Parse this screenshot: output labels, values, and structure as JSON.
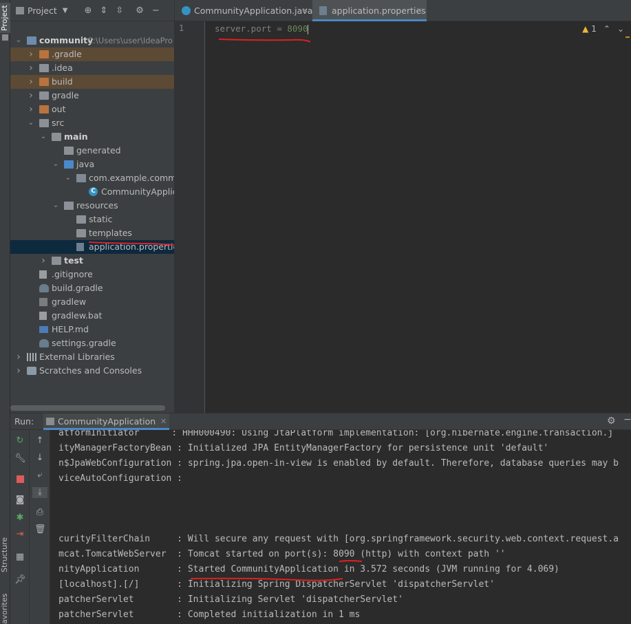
{
  "left_strip": {
    "project_label": "Project",
    "structure_label": "Structure",
    "favorites_label": "avorites"
  },
  "project_panel": {
    "title": "Project",
    "tree": [
      {
        "label": "community",
        "extra": "C:\\Users\\user\\IdeaPro",
        "depth": 0,
        "arrow": "down",
        "icon": "module-folder-icon",
        "bold": true,
        "state": "normal"
      },
      {
        "label": ".gradle",
        "depth": 1,
        "arrow": "right",
        "icon": "folder-orange-icon",
        "state": "highlight"
      },
      {
        "label": ".idea",
        "depth": 1,
        "arrow": "right",
        "icon": "folder-icon",
        "state": "normal"
      },
      {
        "label": "build",
        "depth": 1,
        "arrow": "right",
        "icon": "folder-orange-icon",
        "state": "highlight"
      },
      {
        "label": "gradle",
        "depth": 1,
        "arrow": "right",
        "icon": "folder-icon",
        "state": "normal"
      },
      {
        "label": "out",
        "depth": 1,
        "arrow": "right",
        "icon": "folder-orange-icon",
        "state": "normal"
      },
      {
        "label": "src",
        "depth": 1,
        "arrow": "down",
        "icon": "folder-icon",
        "state": "normal"
      },
      {
        "label": "main",
        "depth": 2,
        "arrow": "down",
        "icon": "folder-icon",
        "bold": true,
        "state": "normal"
      },
      {
        "label": "generated",
        "depth": 3,
        "arrow": "",
        "icon": "generated-folder-icon",
        "state": "normal"
      },
      {
        "label": "java",
        "depth": 3,
        "arrow": "down",
        "icon": "source-folder-icon",
        "state": "normal"
      },
      {
        "label": "com.example.commun",
        "depth": 4,
        "arrow": "down",
        "icon": "package-icon",
        "state": "normal"
      },
      {
        "label": "CommunityApplicat",
        "depth": 5,
        "arrow": "",
        "icon": "class-icon",
        "state": "normal"
      },
      {
        "label": "resources",
        "depth": 3,
        "arrow": "down",
        "icon": "resources-folder-icon",
        "state": "normal"
      },
      {
        "label": "static",
        "depth": 4,
        "arrow": "",
        "icon": "folder-icon",
        "state": "normal"
      },
      {
        "label": "templates",
        "depth": 4,
        "arrow": "",
        "icon": "folder-icon",
        "state": "normal"
      },
      {
        "label": "application.properties",
        "depth": 4,
        "arrow": "",
        "icon": "properties-file-icon",
        "state": "selected"
      },
      {
        "label": "test",
        "depth": 2,
        "arrow": "right",
        "icon": "folder-icon",
        "bold": true,
        "state": "normal"
      },
      {
        "label": ".gitignore",
        "depth": 1,
        "arrow": "",
        "icon": "text-file-icon",
        "state": "normal"
      },
      {
        "label": "build.gradle",
        "depth": 1,
        "arrow": "",
        "icon": "gradle-icon",
        "state": "normal"
      },
      {
        "label": "gradlew",
        "depth": 1,
        "arrow": "",
        "icon": "terminal-file-icon",
        "state": "normal"
      },
      {
        "label": "gradlew.bat",
        "depth": 1,
        "arrow": "",
        "icon": "text-file-icon",
        "state": "normal"
      },
      {
        "label": "HELP.md",
        "depth": 1,
        "arrow": "",
        "icon": "markdown-icon",
        "state": "normal"
      },
      {
        "label": "settings.gradle",
        "depth": 1,
        "arrow": "",
        "icon": "gradle-icon",
        "state": "normal"
      },
      {
        "label": "External Libraries",
        "depth": 0,
        "arrow": "right",
        "icon": "libraries-icon",
        "state": "normal"
      },
      {
        "label": "Scratches and Consoles",
        "depth": 0,
        "arrow": "right",
        "icon": "scratches-icon",
        "state": "normal"
      }
    ]
  },
  "editor": {
    "tabs": [
      {
        "label": "CommunityApplication.java",
        "icon": "java-class-icon",
        "active": false
      },
      {
        "label": "application.properties",
        "icon": "properties-file-icon",
        "active": true
      }
    ],
    "line_number": "1",
    "code": {
      "key": "server.port",
      "eq": " = ",
      "value": "8090"
    },
    "inspection": {
      "warning_count": "1"
    }
  },
  "run_panel": {
    "label": "Run:",
    "tab_label": "CommunityApplication",
    "console_lines": [
      "atformInitiator      : HHH000490: Using JtaPlatform implementation: [org.hibernate.engine.transaction.j",
      "ityManagerFactoryBean : Initialized JPA EntityManagerFactory for persistence unit 'default'",
      "n$JpaWebConfiguration : spring.jpa.open-in-view is enabled by default. Therefore, database queries may b",
      "viceAutoConfiguration :",
      "",
      "",
      "",
      "curityFilterChain     : Will secure any request with [org.springframework.security.web.context.request.a",
      "mcat.TomcatWebServer  : Tomcat started on port(s): 8090 (http) with context path ''",
      "nityApplication       : Started CommunityApplication in 3.572 seconds (JVM running for 4.069)",
      "[localhost].[/]       : Initializing Spring DispatcherServlet 'dispatcherServlet'",
      "patcherServlet        : Initializing Servlet 'dispatcherServlet'",
      "patcherServlet        : Completed initialization in 1 ms"
    ]
  }
}
